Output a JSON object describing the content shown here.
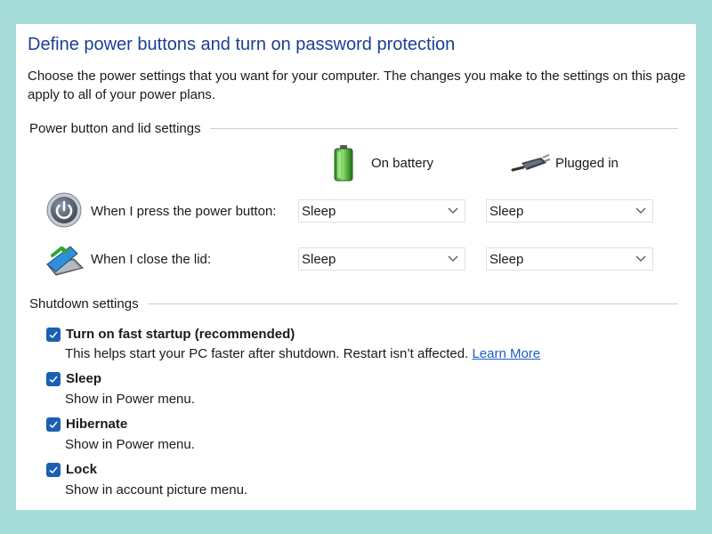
{
  "header": {
    "title": "Define power buttons and turn on password protection",
    "description": "Choose the power settings that you want for your computer. The changes you make to the settings on this page apply to all of your power plans."
  },
  "power_section": {
    "title": "Power button and lid settings",
    "columns": {
      "battery": {
        "label": "On battery",
        "icon": "battery-icon"
      },
      "plugged": {
        "label": "Plugged in",
        "icon": "power-plug-icon"
      }
    },
    "rows": [
      {
        "label": "When I press the power button:",
        "icon": "power-button-icon",
        "battery_value": "Sleep",
        "plugged_value": "Sleep"
      },
      {
        "label": "When I close the lid:",
        "icon": "laptop-lid-icon",
        "battery_value": "Sleep",
        "plugged_value": "Sleep"
      }
    ]
  },
  "shutdown_section": {
    "title": "Shutdown settings",
    "items": [
      {
        "label": "Turn on fast startup (recommended)",
        "checked": true,
        "description": "This helps start your PC faster after shutdown. Restart isn’t affected.",
        "link": "Learn More"
      },
      {
        "label": "Sleep",
        "checked": true,
        "description": "Show in Power menu."
      },
      {
        "label": "Hibernate",
        "checked": true,
        "description": "Show in Power menu."
      },
      {
        "label": "Lock",
        "checked": true,
        "description": "Show in account picture menu."
      }
    ]
  },
  "colors": {
    "background": "#a6dcd8",
    "title": "#1c3f94",
    "checkbox": "#1a5fb4",
    "link": "#1c5fc4"
  }
}
